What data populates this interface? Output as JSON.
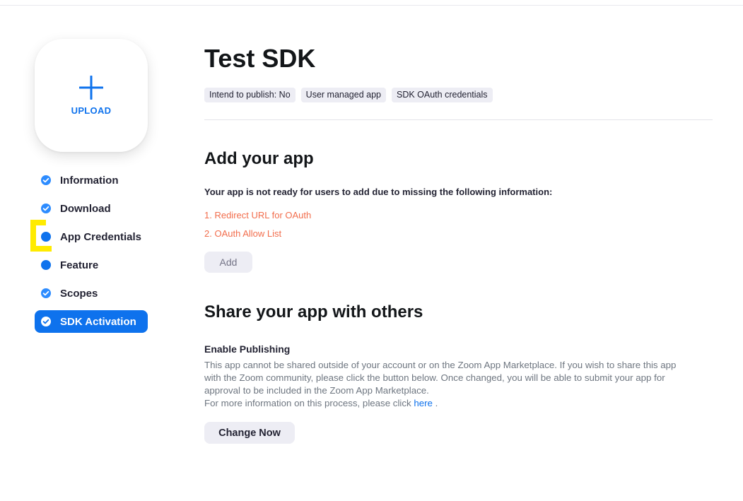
{
  "upload": {
    "label": "UPLOAD",
    "icon": "plus-icon"
  },
  "sidebar": {
    "items": [
      {
        "label": "Information",
        "state": "done",
        "icon": "check-circle-icon"
      },
      {
        "label": "Download",
        "state": "done",
        "icon": "check-circle-icon"
      },
      {
        "label": "App Credentials",
        "state": "incomplete",
        "icon": "dot-icon"
      },
      {
        "label": "Feature",
        "state": "incomplete",
        "icon": "dot-icon"
      },
      {
        "label": "Scopes",
        "state": "done",
        "icon": "check-circle-icon"
      },
      {
        "label": "SDK Activation",
        "state": "active",
        "icon": "check-circle-icon"
      }
    ]
  },
  "header": {
    "title": "Test SDK",
    "tags": [
      "Intend to publish: No",
      "User managed app",
      "SDK OAuth credentials"
    ]
  },
  "add_app": {
    "heading": "Add your app",
    "warning": "Your app is not ready for users to add due to missing the following information:",
    "missing": [
      "1. Redirect URL for OAuth",
      "2. OAuth Allow List"
    ],
    "button": "Add"
  },
  "share": {
    "heading": "Share your app with others",
    "subheading": "Enable Publishing",
    "desc_line1": "This app cannot be shared outside of your account or on the Zoom App Marketplace. If you wish to share this app",
    "desc_line2": "with the Zoom community, please click the button below. Once changed, you will be able to submit your app for",
    "desc_line3": "approval to be included in the Zoom App Marketplace.",
    "desc_line4_prefix": "For more information on this process, please click ",
    "desc_link": "here",
    "desc_line4_suffix": " .",
    "button": "Change Now"
  },
  "colors": {
    "accent": "#0e72ed",
    "warning_text": "#f26d4c",
    "tag_bg": "#ededf4",
    "highlight": "#ffeb00"
  }
}
